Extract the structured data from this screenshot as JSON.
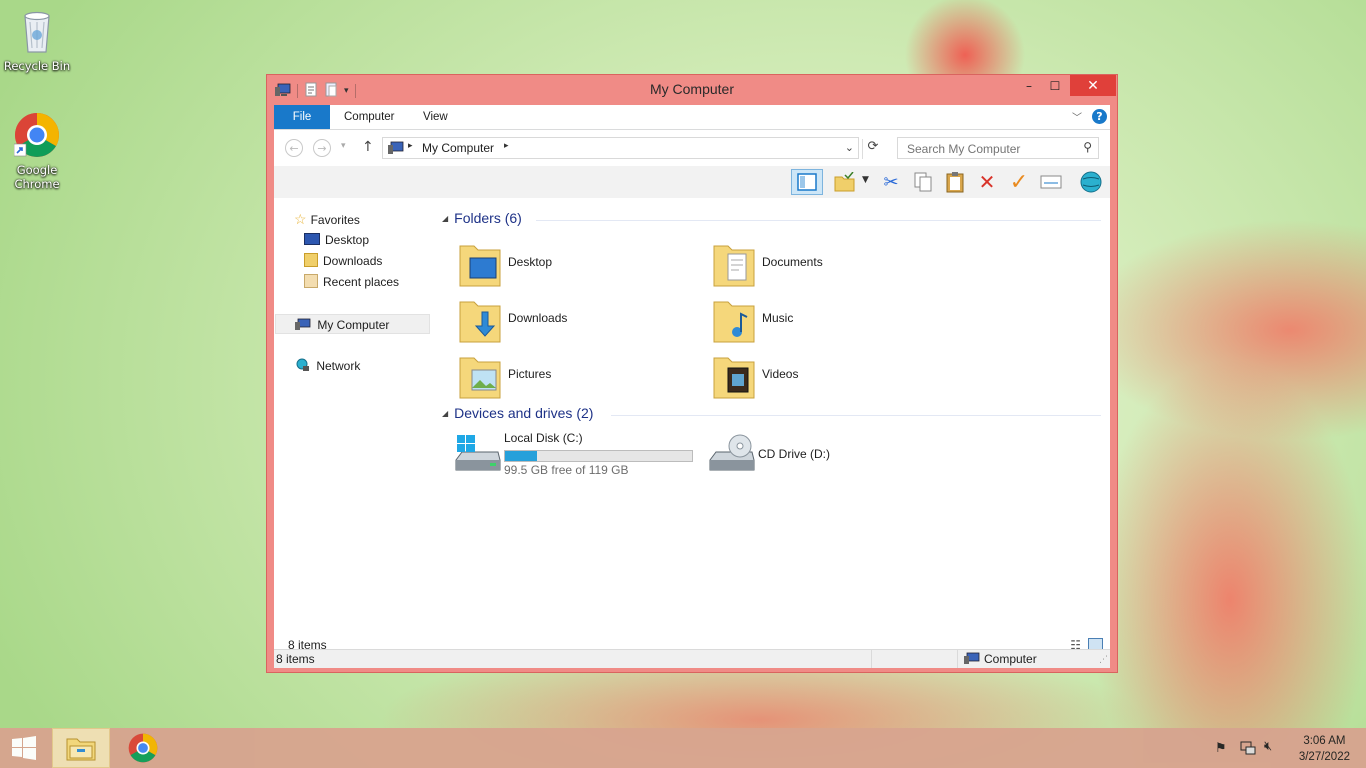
{
  "desktop": {
    "icons": [
      {
        "label": "Recycle Bin"
      },
      {
        "label": "Google\nChrome"
      }
    ]
  },
  "window": {
    "title": "My Computer",
    "controls": {
      "minimize": "–",
      "maximize": "☐",
      "close": "✕"
    },
    "ribbon": {
      "tabs": [
        "File",
        "Computer",
        "View"
      ],
      "help": "?"
    },
    "address": {
      "path": "My Computer",
      "search_placeholder": "Search My Computer"
    },
    "nav": {
      "favorites": "Favorites",
      "favorite_items": [
        "Desktop",
        "Downloads",
        "Recent places"
      ],
      "my_computer": "My Computer",
      "network": "Network"
    },
    "content": {
      "folders_header": "Folders (6)",
      "folders": [
        "Desktop",
        "Documents",
        "Downloads",
        "Music",
        "Pictures",
        "Videos"
      ],
      "devices_header": "Devices and drives (2)",
      "drives": [
        {
          "name": "Local Disk (C:)",
          "free_text": "99.5 GB free of 119 GB",
          "used_fraction": 0.17
        },
        {
          "name": "CD Drive (D:)"
        }
      ]
    },
    "status": {
      "items_inner": "8 items",
      "items_bottom": "8 items",
      "location": "Computer"
    }
  },
  "taskbar": {
    "time": "3:06 AM",
    "date": "3/27/2022"
  },
  "colors": {
    "window_frame": "#f08b86",
    "accent": "#1979ca",
    "close": "#e0403a",
    "drive_bar": "#26a0da",
    "group_header": "#1e3287"
  }
}
